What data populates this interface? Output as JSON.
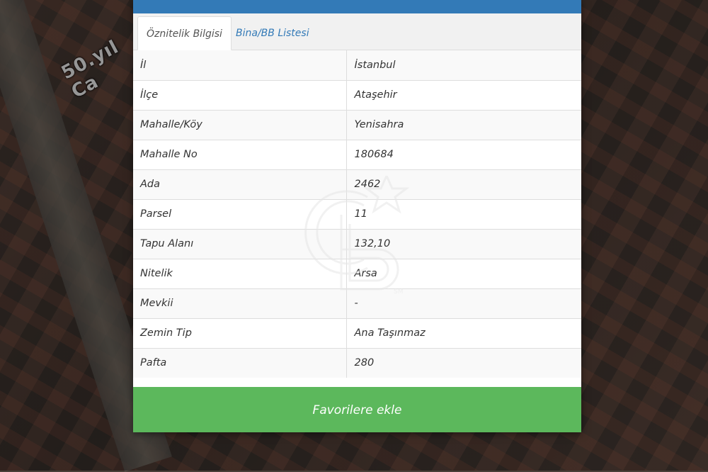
{
  "map": {
    "road_label": "50.yıl Ca"
  },
  "tabs": [
    {
      "label": "Öznitelik Bilgisi",
      "active": true
    },
    {
      "label": "Bina/BB Listesi",
      "active": false
    }
  ],
  "attributes": [
    {
      "key": "İl",
      "value": "İstanbul"
    },
    {
      "key": "İlçe",
      "value": "Ataşehir"
    },
    {
      "key": "Mahalle/Köy",
      "value": "Yenisahra"
    },
    {
      "key": "Mahalle No",
      "value": "180684"
    },
    {
      "key": "Ada",
      "value": "2462"
    },
    {
      "key": "Parsel",
      "value": "11"
    },
    {
      "key": "Tapu Alanı",
      "value": "132,10"
    },
    {
      "key": "Nitelik",
      "value": "Arsa"
    },
    {
      "key": "Mevkii",
      "value": "-"
    },
    {
      "key": "Zemin Tip",
      "value": "Ana Taşınmaz"
    },
    {
      "key": "Pafta",
      "value": "280"
    }
  ],
  "actions": {
    "favorite_label": "Favorilere ekle"
  },
  "watermark": {
    "text": "CB",
    "mark": "SM"
  },
  "colors": {
    "header": "#337ab7",
    "button": "#5cb85c",
    "link": "#337ab7"
  }
}
